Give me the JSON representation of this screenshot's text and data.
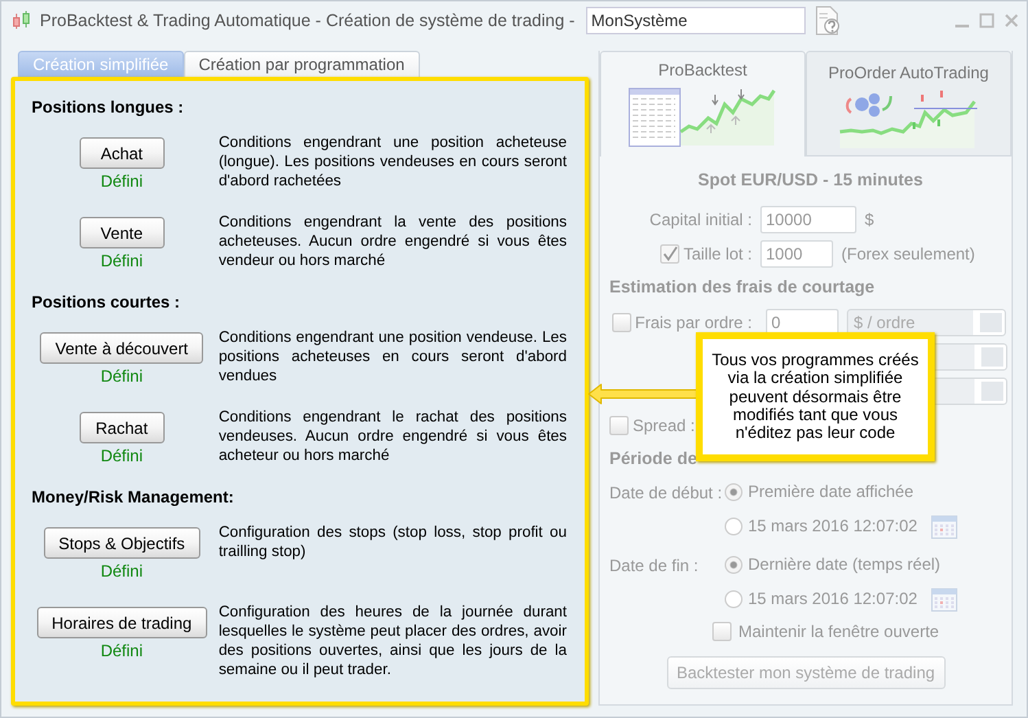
{
  "window": {
    "title": "ProBacktest & Trading Automatique - Création de système de trading  -",
    "system_name": "MonSystème"
  },
  "mode_tabs": [
    {
      "label": "Création simplifiée",
      "selected": true
    },
    {
      "label": "Création par programmation",
      "selected": false
    }
  ],
  "sections": [
    {
      "heading": "Positions longues :",
      "items": [
        {
          "button": "Achat",
          "status": "Défini",
          "description": "Conditions engendrant une position acheteuse (longue). Les positions vendeuses en cours seront d'abord rachetées"
        },
        {
          "button": "Vente",
          "status": "Défini",
          "description": "Conditions engendrant la vente des positions acheteuses. Aucun ordre engendré si vous êtes vendeur ou hors marché"
        }
      ]
    },
    {
      "heading": "Positions courtes :",
      "items": [
        {
          "button": "Vente à découvert",
          "status": "Défini",
          "description": "Conditions engendrant une position vendeuse. Les positions acheteuses en cours seront d'abord vendues"
        },
        {
          "button": "Rachat",
          "status": "Défini",
          "description": "Conditions engendrant le rachat des positions vendeuses. Aucun ordre engendré si vous êtes acheteur ou hors marché"
        }
      ]
    },
    {
      "heading": "Money/Risk Management:",
      "items": [
        {
          "button": "Stops & Objectifs",
          "status": "Défini",
          "description": "Configuration des stops (stop loss, stop profit ou trailling stop)"
        },
        {
          "button": "Horaires de trading",
          "status": "Défini",
          "description": "Configuration des heures de la journée durant lesquelles le système peut placer des ordres, avoir des positions ouvertes, ainsi que les jours de la semaine ou il peut trader."
        }
      ]
    }
  ],
  "backtest_panel": {
    "disabled": true,
    "tabs": [
      {
        "label": "ProBacktest",
        "selected": true
      },
      {
        "label": "ProOrder AutoTrading",
        "selected": false
      }
    ],
    "instrument": "Spot EUR/USD - 15 minutes",
    "capital": {
      "label": "Capital initial :",
      "value": "10000",
      "unit": "$"
    },
    "lot": {
      "label": "Taille lot :",
      "checked": true,
      "value": "1000",
      "note": "(Forex seulement)"
    },
    "fees_heading": "Estimation des frais de courtage",
    "fee_per_order": {
      "label": "Frais par ordre :",
      "checked": false,
      "value": "0",
      "unit": "$ / ordre"
    },
    "spread": {
      "label": "Spread :",
      "checked": false
    },
    "period_heading": "Période de",
    "start": {
      "label": "Date de début :",
      "options": [
        {
          "label": "Première date affichée",
          "selected": true
        },
        {
          "label": "15 mars 2016 12:07:02",
          "selected": false
        }
      ]
    },
    "end": {
      "label": "Date de fin :",
      "options": [
        {
          "label": "Dernière date (temps réel)",
          "selected": true
        },
        {
          "label": "15 mars 2016 12:07:02",
          "selected": false
        }
      ]
    },
    "keep_open": {
      "label": "Maintenir la fenêtre ouverte",
      "checked": false
    },
    "run_button": "Backtester mon système de trading"
  },
  "callout": {
    "text": "Tous vos programmes créés via la création simplifiée peuvent désormais être modifiés tant que vous n'éditez pas leur code"
  }
}
